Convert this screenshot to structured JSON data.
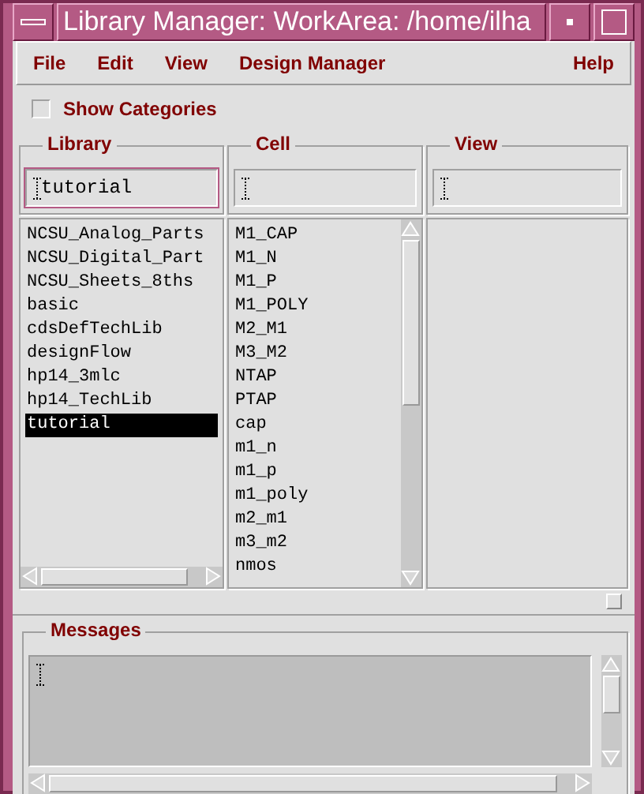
{
  "window": {
    "title": "Library Manager: WorkArea: /home/ilha"
  },
  "menu": [
    {
      "label": "File"
    },
    {
      "label": "Edit"
    },
    {
      "label": "View"
    },
    {
      "label": "Design Manager"
    }
  ],
  "help_menu": {
    "label": "Help"
  },
  "show_categories": {
    "label": "Show Categories",
    "checked": false
  },
  "columns": [
    {
      "label": "Library",
      "value": "tutorial",
      "items": [
        {
          "label": "NCSU_Analog_Parts",
          "selected": false
        },
        {
          "label": "NCSU_Digital_Part",
          "selected": false
        },
        {
          "label": "NCSU_Sheets_8ths",
          "selected": false
        },
        {
          "label": "basic",
          "selected": false
        },
        {
          "label": "cdsDefTechLib",
          "selected": false
        },
        {
          "label": "designFlow",
          "selected": false
        },
        {
          "label": "hp14_3mlc",
          "selected": false
        },
        {
          "label": "hp14_TechLib",
          "selected": false
        },
        {
          "label": "tutorial",
          "selected": true
        }
      ]
    },
    {
      "label": "Cell",
      "items": [
        {
          "label": "M1_CAP",
          "selected": false
        },
        {
          "label": "M1_N",
          "selected": false
        },
        {
          "label": "M1_P",
          "selected": false
        },
        {
          "label": "M1_POLY",
          "selected": false
        },
        {
          "label": "M2_M1",
          "selected": false
        },
        {
          "label": "M3_M2",
          "selected": false
        },
        {
          "label": "NTAP",
          "selected": false
        },
        {
          "label": "PTAP",
          "selected": false
        },
        {
          "label": "cap",
          "selected": false
        },
        {
          "label": "m1_n",
          "selected": false
        },
        {
          "label": "m1_p",
          "selected": false
        },
        {
          "label": "m1_poly",
          "selected": false
        },
        {
          "label": "m2_m1",
          "selected": false
        },
        {
          "label": "m3_m2",
          "selected": false
        },
        {
          "label": "nmos",
          "selected": false
        }
      ]
    },
    {
      "label": "View"
    }
  ],
  "messages": {
    "label": "Messages"
  }
}
